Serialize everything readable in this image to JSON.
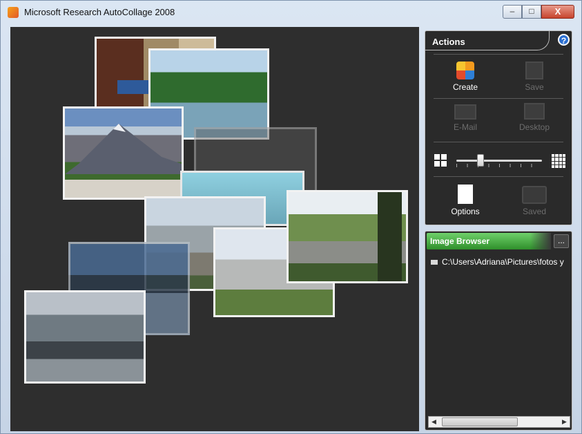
{
  "window": {
    "title": "Microsoft Research AutoCollage 2008"
  },
  "actions": {
    "title": "Actions",
    "help": "?",
    "create": "Create",
    "save": "Save",
    "email": "E-Mail",
    "desktop": "Desktop",
    "options": "Options",
    "saved": "Saved",
    "slider_level": 0.28
  },
  "browser": {
    "title": "Image Browser",
    "more": "...",
    "path": "C:\\Users\\Adriana\\Pictures\\fotos y"
  },
  "controls": {
    "minimize": "–",
    "maximize": "□",
    "close": "X"
  }
}
